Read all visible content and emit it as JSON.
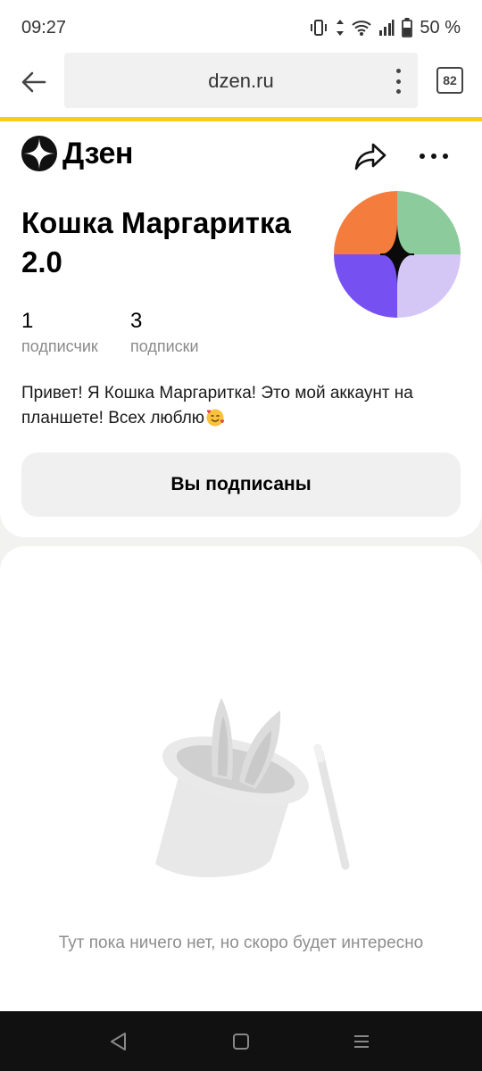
{
  "status_bar": {
    "time": "09:27",
    "battery": "50 %"
  },
  "browser": {
    "url": "dzen.ru",
    "tab_count": "82"
  },
  "header": {
    "logo_text": "Дзен"
  },
  "profile": {
    "name": "Кошка Маргаритка 2.0",
    "stats": [
      {
        "value": "1",
        "label": "подписчик"
      },
      {
        "value": "3",
        "label": "подписки"
      }
    ],
    "bio": "Привет! Я Кошка Маргаритка! Это мой аккаунт на планшете! Всех люблю",
    "subscribe_label": "Вы подписаны"
  },
  "feed": {
    "empty_message": "Тут пока ничего нет, но скоро будет интересно"
  },
  "colors": {
    "accent_line": "#fcca1d",
    "avatar_orange": "#f47c3c",
    "avatar_green": "#8ccb9b",
    "avatar_purple": "#7650f0",
    "avatar_lilac": "#d4c6f5"
  },
  "icons": [
    "vibrate-icon",
    "data-arrows-icon",
    "wifi-icon",
    "signal-icon",
    "battery-icon",
    "back-arrow-icon",
    "menu-dots-icon",
    "tabs-icon",
    "dzen-logo-icon",
    "share-icon",
    "more-icon",
    "magic-hat-icon",
    "nav-back-icon",
    "nav-home-icon",
    "nav-recents-icon"
  ]
}
